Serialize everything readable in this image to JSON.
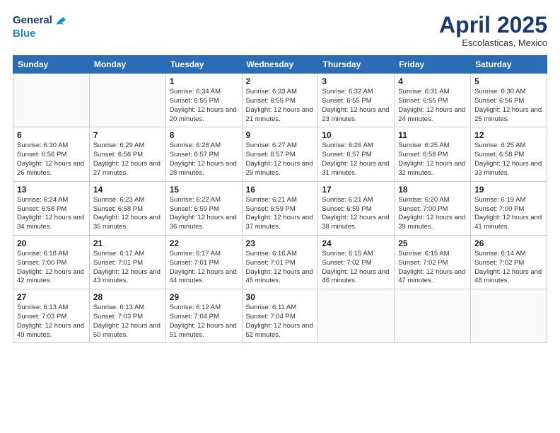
{
  "logo": {
    "line1": "General",
    "line2": "Blue"
  },
  "title": "April 2025",
  "subtitle": "Escolasticas, Mexico",
  "weekdays": [
    "Sunday",
    "Monday",
    "Tuesday",
    "Wednesday",
    "Thursday",
    "Friday",
    "Saturday"
  ],
  "weeks": [
    [
      {
        "day": "",
        "info": ""
      },
      {
        "day": "",
        "info": ""
      },
      {
        "day": "1",
        "info": "Sunrise: 6:34 AM\nSunset: 6:55 PM\nDaylight: 12 hours and 20 minutes."
      },
      {
        "day": "2",
        "info": "Sunrise: 6:33 AM\nSunset: 6:55 PM\nDaylight: 12 hours and 21 minutes."
      },
      {
        "day": "3",
        "info": "Sunrise: 6:32 AM\nSunset: 6:55 PM\nDaylight: 12 hours and 23 minutes."
      },
      {
        "day": "4",
        "info": "Sunrise: 6:31 AM\nSunset: 6:55 PM\nDaylight: 12 hours and 24 minutes."
      },
      {
        "day": "5",
        "info": "Sunrise: 6:30 AM\nSunset: 6:56 PM\nDaylight: 12 hours and 25 minutes."
      }
    ],
    [
      {
        "day": "6",
        "info": "Sunrise: 6:30 AM\nSunset: 6:56 PM\nDaylight: 12 hours and 26 minutes."
      },
      {
        "day": "7",
        "info": "Sunrise: 6:29 AM\nSunset: 6:56 PM\nDaylight: 12 hours and 27 minutes."
      },
      {
        "day": "8",
        "info": "Sunrise: 6:28 AM\nSunset: 6:57 PM\nDaylight: 12 hours and 28 minutes."
      },
      {
        "day": "9",
        "info": "Sunrise: 6:27 AM\nSunset: 6:57 PM\nDaylight: 12 hours and 29 minutes."
      },
      {
        "day": "10",
        "info": "Sunrise: 6:26 AM\nSunset: 6:57 PM\nDaylight: 12 hours and 31 minutes."
      },
      {
        "day": "11",
        "info": "Sunrise: 6:25 AM\nSunset: 6:58 PM\nDaylight: 12 hours and 32 minutes."
      },
      {
        "day": "12",
        "info": "Sunrise: 6:25 AM\nSunset: 6:58 PM\nDaylight: 12 hours and 33 minutes."
      }
    ],
    [
      {
        "day": "13",
        "info": "Sunrise: 6:24 AM\nSunset: 6:58 PM\nDaylight: 12 hours and 34 minutes."
      },
      {
        "day": "14",
        "info": "Sunrise: 6:23 AM\nSunset: 6:58 PM\nDaylight: 12 hours and 35 minutes."
      },
      {
        "day": "15",
        "info": "Sunrise: 6:22 AM\nSunset: 6:59 PM\nDaylight: 12 hours and 36 minutes."
      },
      {
        "day": "16",
        "info": "Sunrise: 6:21 AM\nSunset: 6:59 PM\nDaylight: 12 hours and 37 minutes."
      },
      {
        "day": "17",
        "info": "Sunrise: 6:21 AM\nSunset: 6:59 PM\nDaylight: 12 hours and 38 minutes."
      },
      {
        "day": "18",
        "info": "Sunrise: 6:20 AM\nSunset: 7:00 PM\nDaylight: 12 hours and 39 minutes."
      },
      {
        "day": "19",
        "info": "Sunrise: 6:19 AM\nSunset: 7:00 PM\nDaylight: 12 hours and 41 minutes."
      }
    ],
    [
      {
        "day": "20",
        "info": "Sunrise: 6:18 AM\nSunset: 7:00 PM\nDaylight: 12 hours and 42 minutes."
      },
      {
        "day": "21",
        "info": "Sunrise: 6:17 AM\nSunset: 7:01 PM\nDaylight: 12 hours and 43 minutes."
      },
      {
        "day": "22",
        "info": "Sunrise: 6:17 AM\nSunset: 7:01 PM\nDaylight: 12 hours and 44 minutes."
      },
      {
        "day": "23",
        "info": "Sunrise: 6:16 AM\nSunset: 7:01 PM\nDaylight: 12 hours and 45 minutes."
      },
      {
        "day": "24",
        "info": "Sunrise: 6:15 AM\nSunset: 7:02 PM\nDaylight: 12 hours and 46 minutes."
      },
      {
        "day": "25",
        "info": "Sunrise: 6:15 AM\nSunset: 7:02 PM\nDaylight: 12 hours and 47 minutes."
      },
      {
        "day": "26",
        "info": "Sunrise: 6:14 AM\nSunset: 7:02 PM\nDaylight: 12 hours and 48 minutes."
      }
    ],
    [
      {
        "day": "27",
        "info": "Sunrise: 6:13 AM\nSunset: 7:03 PM\nDaylight: 12 hours and 49 minutes."
      },
      {
        "day": "28",
        "info": "Sunrise: 6:13 AM\nSunset: 7:03 PM\nDaylight: 12 hours and 50 minutes."
      },
      {
        "day": "29",
        "info": "Sunrise: 6:12 AM\nSunset: 7:04 PM\nDaylight: 12 hours and 51 minutes."
      },
      {
        "day": "30",
        "info": "Sunrise: 6:11 AM\nSunset: 7:04 PM\nDaylight: 12 hours and 52 minutes."
      },
      {
        "day": "",
        "info": ""
      },
      {
        "day": "",
        "info": ""
      },
      {
        "day": "",
        "info": ""
      }
    ]
  ]
}
